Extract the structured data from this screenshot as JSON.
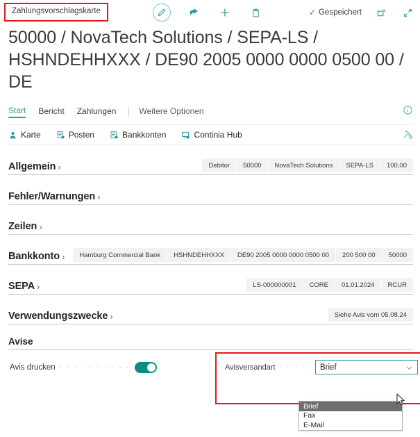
{
  "topbar": {
    "tab_chip": "Zahlungsvorschlagskarte",
    "icons": [
      {
        "name": "edit-pencil-icon"
      },
      {
        "name": "share-icon"
      },
      {
        "name": "add-new-icon"
      },
      {
        "name": "delete-trash-icon"
      }
    ],
    "saved_label": "Gespeichert",
    "open_new_window_icon": "open-in-new-window-icon",
    "expand_icon": "expand-fullscreen-icon"
  },
  "page": {
    "title": "50000 / NovaTech Solutions / SEPA-LS / HSHNDEHHXXX / DE90 2005 0000 0000 0500 00 / DE"
  },
  "tabs": [
    {
      "label": "Start",
      "active": true
    },
    {
      "label": "Bericht",
      "active": false
    },
    {
      "label": "Zahlungen",
      "active": false
    },
    {
      "label": "Weitere Optionen",
      "active": false
    }
  ],
  "tabstrip": {
    "info_icon": "info-circle-icon"
  },
  "actions": [
    {
      "label": "Karte",
      "icon": "person-card-icon"
    },
    {
      "label": "Posten",
      "icon": "ledger-entries-icon"
    },
    {
      "label": "Bankkonten",
      "icon": "bank-accounts-icon"
    },
    {
      "label": "Continia Hub",
      "icon": "continia-hub-icon"
    }
  ],
  "actionbar": {
    "personalize_icon": "personalize-icon"
  },
  "sections": [
    {
      "title": "Allgemein",
      "expandable": true,
      "badges": [
        "Debitor",
        "50000",
        "NovaTech Solutions",
        "SEPA-LS",
        "100,00"
      ]
    },
    {
      "title": "Fehler/Warnungen",
      "expandable": true,
      "badges": []
    },
    {
      "title": "Zeilen",
      "expandable": true,
      "badges": []
    },
    {
      "title": "Bankkonto",
      "expandable": true,
      "badges": [
        "Hamburg Commercial Bank",
        "HSHNDEHHXXX",
        "DE90 2005 0000 0000 0500 00",
        "200 500 00",
        "50000"
      ]
    },
    {
      "title": "SEPA",
      "expandable": true,
      "badges": [
        "LS-000000001",
        "CORE",
        "01.01.2024",
        "RCUR"
      ]
    },
    {
      "title": "Verwendungszwecke",
      "expandable": true,
      "badges": [
        "Siehe Avis vom 05.08.24"
      ]
    }
  ],
  "avise": {
    "title": "Avise",
    "print_label": "Avis drucken",
    "print_dots": "· · · · · · · · · ·",
    "print_toggle_on": true,
    "toggle_color": "#0f8a8a",
    "dispatch_label": "Avisversandart",
    "dispatch_dots": "· · · · · · · · ·",
    "dispatch_value": "Brief",
    "dropdown_open": true,
    "dropdown_options": [
      {
        "label": "Brief",
        "selected": true
      },
      {
        "label": "Fax",
        "selected": false
      },
      {
        "label": "E-Mail",
        "selected": false
      }
    ],
    "highlight_color": "#e21b1b",
    "focus_border_color": "#2e9b9b"
  }
}
